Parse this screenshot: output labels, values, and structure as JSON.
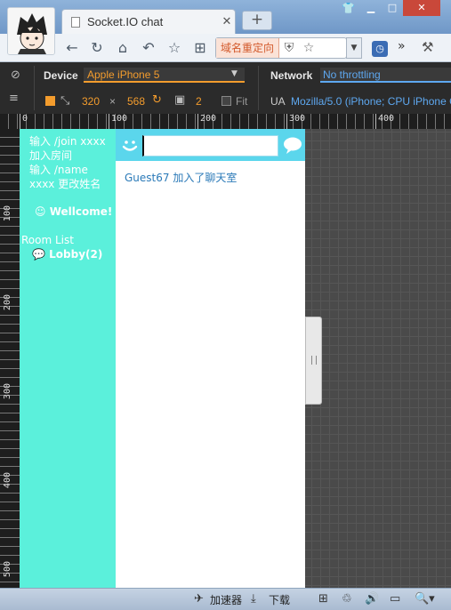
{
  "browser": {
    "tab_title": "Socket.IO chat",
    "tab_close": "✕",
    "new_tab": "+",
    "redirect_label": "域名重定向",
    "overflow_chevron": "»"
  },
  "devtools": {
    "device_label": "Device",
    "device_value": "Apple iPhone 5",
    "width": "320",
    "times": "×",
    "height": "568",
    "dpr": "2",
    "fit_label": "Fit",
    "network_label": "Network",
    "network_value": "No throttling",
    "ua_label": "UA",
    "ua_value": "Mozilla/5.0 (iPhone; CPU iPhone O",
    "ruler_top": [
      "0",
      "100",
      "200",
      "300",
      "400"
    ],
    "ruler_left": [
      "100",
      "200",
      "300",
      "400",
      "500"
    ]
  },
  "chat": {
    "help_lines": [
      "输入 /join xxxx",
      "加入房间",
      "输入 /name",
      "xxxx 更改姓名"
    ],
    "welcome": "Wellcome!",
    "room_list_label": "Room List",
    "rooms": [
      {
        "name": "Lobby(2)"
      }
    ],
    "input_value": "",
    "messages": [
      "Guest67 加入了聊天室"
    ]
  },
  "statusbar": {
    "accelerator": "加速器",
    "download": "下载"
  },
  "icons": [
    "avatar-image",
    "doc-icon",
    "back-icon",
    "reload-icon",
    "home-icon",
    "undo-icon",
    "star-icon",
    "extension-icon",
    "shield-icon",
    "clock-icon",
    "wrench-icon",
    "smile-icon",
    "chat-bubble-icon"
  ],
  "colors": {
    "sidebar": "#5bf0db",
    "chatbar": "#5bd6ec",
    "accent_orange": "#f39c2d",
    "accent_blue": "#5ea8f0",
    "message_text": "#2b7ab8"
  }
}
